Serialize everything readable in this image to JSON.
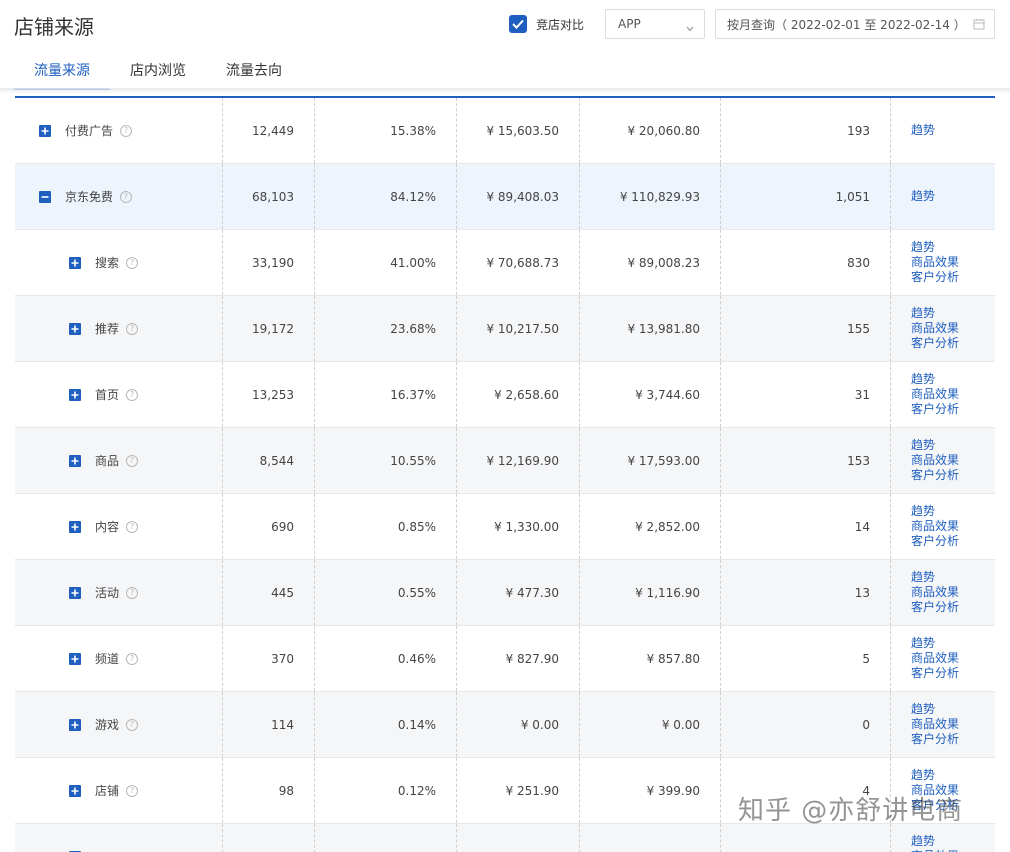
{
  "header": {
    "title": "店铺来源",
    "compare_label": "竞店对比",
    "compare_checked": true,
    "platform_select": "APP",
    "date_range": "按月查询（ 2022-02-01 至 2022-02-14 ）"
  },
  "tabs": [
    {
      "label": "流量来源",
      "active": true
    },
    {
      "label": "店内浏览",
      "active": false
    },
    {
      "label": "流量去向",
      "active": false
    }
  ],
  "links": {
    "trend": "趋势",
    "product_effect": "商品效果",
    "customer_analysis": "客户分析"
  },
  "rows": [
    {
      "name": "付费广告",
      "level": 0,
      "expanded": false,
      "visitors": "12,449",
      "share": "15.38%",
      "amount1": "¥ 15,603.50",
      "amount2": "¥ 20,060.80",
      "count": "193"
    },
    {
      "name": "京东免费",
      "level": 0,
      "expanded": true,
      "visitors": "68,103",
      "share": "84.12%",
      "amount1": "¥ 89,408.03",
      "amount2": "¥ 110,829.93",
      "count": "1,051"
    },
    {
      "name": "搜索",
      "level": 1,
      "expanded": false,
      "visitors": "33,190",
      "share": "41.00%",
      "amount1": "¥ 70,688.73",
      "amount2": "¥ 89,008.23",
      "count": "830"
    },
    {
      "name": "推荐",
      "level": 1,
      "expanded": false,
      "visitors": "19,172",
      "share": "23.68%",
      "amount1": "¥ 10,217.50",
      "amount2": "¥ 13,981.80",
      "count": "155"
    },
    {
      "name": "首页",
      "level": 1,
      "expanded": false,
      "visitors": "13,253",
      "share": "16.37%",
      "amount1": "¥ 2,658.60",
      "amount2": "¥ 3,744.60",
      "count": "31"
    },
    {
      "name": "商品",
      "level": 1,
      "expanded": false,
      "visitors": "8,544",
      "share": "10.55%",
      "amount1": "¥ 12,169.90",
      "amount2": "¥ 17,593.00",
      "count": "153"
    },
    {
      "name": "内容",
      "level": 1,
      "expanded": false,
      "visitors": "690",
      "share": "0.85%",
      "amount1": "¥ 1,330.00",
      "amount2": "¥ 2,852.00",
      "count": "14"
    },
    {
      "name": "活动",
      "level": 1,
      "expanded": false,
      "visitors": "445",
      "share": "0.55%",
      "amount1": "¥ 477.30",
      "amount2": "¥ 1,116.90",
      "count": "13"
    },
    {
      "name": "频道",
      "level": 1,
      "expanded": false,
      "visitors": "370",
      "share": "0.46%",
      "amount1": "¥ 827.90",
      "amount2": "¥ 857.80",
      "count": "5"
    },
    {
      "name": "游戏",
      "level": 1,
      "expanded": false,
      "visitors": "114",
      "share": "0.14%",
      "amount1": "¥ 0.00",
      "amount2": "¥ 0.00",
      "count": "0"
    },
    {
      "name": "店铺",
      "level": 1,
      "expanded": false,
      "visitors": "98",
      "share": "0.12%",
      "amount1": "¥ 251.90",
      "amount2": "¥ 399.90",
      "count": "4"
    },
    {
      "name": "",
      "level": 1,
      "expanded": false,
      "visitors": "",
      "share": "",
      "amount1": "",
      "amount2": "",
      "count": ""
    }
  ],
  "watermark": "知乎 @亦舒讲电商",
  "colors": {
    "accent": "#1f5fbf",
    "row_alt": "#f5f6f8",
    "row_expanded": "#eef4fc"
  }
}
